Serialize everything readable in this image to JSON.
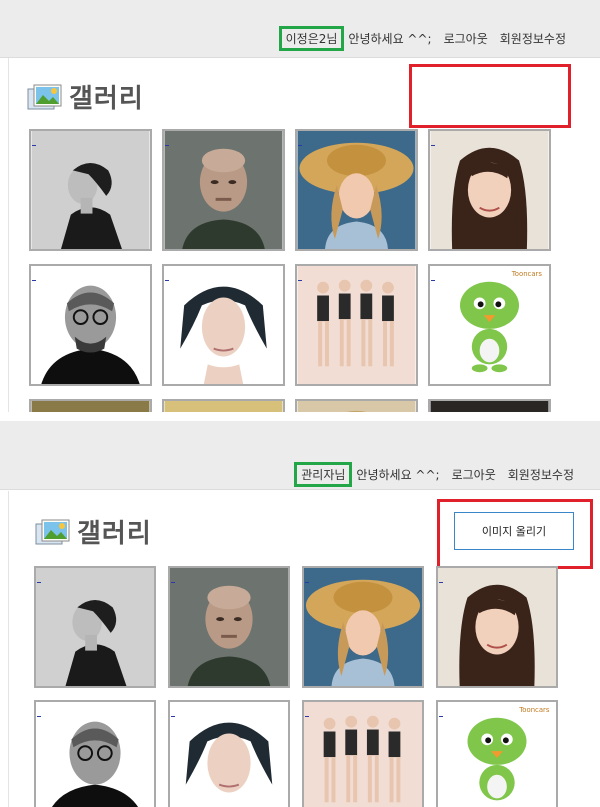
{
  "user_view": {
    "username": "이정은2님",
    "greeting": "안녕하세요 ^^;",
    "logout": "로그아웃",
    "edit_profile": "회원정보수정",
    "title": "갤러리"
  },
  "admin_view": {
    "username": "관리자님",
    "greeting": "안녕하세요 ^^;",
    "logout": "로그아웃",
    "edit_profile": "회원정보수정",
    "title": "갤러리",
    "upload_button": "이미지 올리기"
  },
  "thumbnail_watermark": "Tooncars",
  "colors": {
    "highlight_green": "#22a647",
    "highlight_red": "#e0202a",
    "button_border": "#3a86c8",
    "topbar_bg": "#ececec"
  }
}
